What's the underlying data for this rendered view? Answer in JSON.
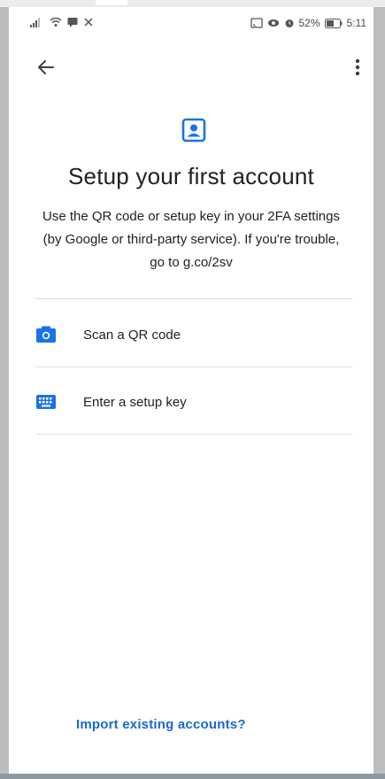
{
  "status_bar": {
    "battery": "52%",
    "time": "5:11"
  },
  "colors": {
    "accent": "#1a73e8",
    "link": "#1967d2",
    "text": "#202124",
    "divider": "#e0e0e0"
  },
  "icons": {
    "back": "arrow-left-icon",
    "more": "more-vert-icon",
    "hero": "account-box-icon",
    "scan": "camera-icon",
    "key": "keyboard-icon"
  },
  "main": {
    "title": "Setup your first account",
    "description": "Use the QR code or setup key in your 2FA settings (by Google or third-party service). If you're trouble, go to g.co/2sv"
  },
  "options": [
    {
      "label": "Scan a QR code"
    },
    {
      "label": "Enter a setup key"
    }
  ],
  "footer": {
    "import_label": "Import existing accounts?"
  }
}
